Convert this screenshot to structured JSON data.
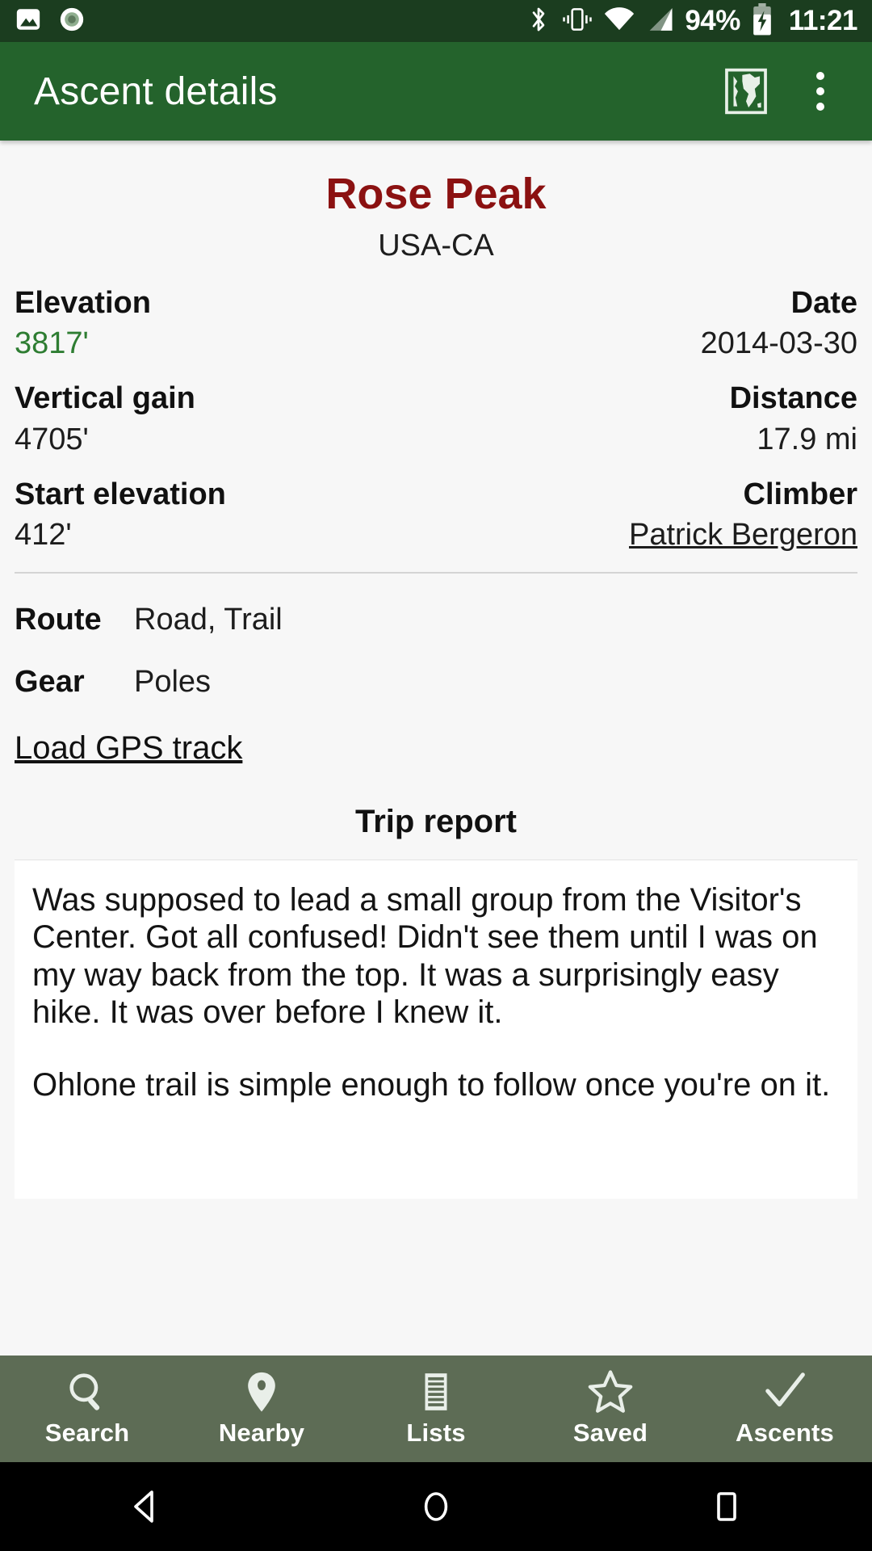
{
  "status_bar": {
    "left_icons": [
      "image-icon",
      "record-icon"
    ],
    "right_icons": [
      "bluetooth-icon",
      "vibrate-icon",
      "wifi-icon",
      "signal-icon"
    ],
    "battery_percent": "94%",
    "battery_state": "charging",
    "clock": "11:21"
  },
  "app_bar": {
    "title": "Ascent details",
    "actions": [
      "world-map-icon",
      "overflow-menu-icon"
    ]
  },
  "peak": {
    "name": "Rose Peak",
    "region": "USA-CA"
  },
  "stats": [
    {
      "left_label": "Elevation",
      "left_value": "3817'",
      "left_style": "green",
      "right_label": "Date",
      "right_value": "2014-03-30",
      "right_style": "plain"
    },
    {
      "left_label": "Vertical gain",
      "left_value": "4705'",
      "left_style": "plain",
      "right_label": "Distance",
      "right_value": "17.9 mi",
      "right_style": "plain"
    },
    {
      "left_label": "Start elevation",
      "left_value": "412'",
      "left_style": "plain",
      "right_label": "Climber",
      "right_value": "Patrick Bergeron",
      "right_style": "link"
    }
  ],
  "details": [
    {
      "key": "Route",
      "value": "Road, Trail"
    },
    {
      "key": "Gear",
      "value": "Poles"
    }
  ],
  "gps_link": "Load GPS track",
  "trip_report": {
    "heading": "Trip report",
    "paragraphs": [
      "Was supposed to lead a small group from the Visitor's Center. Got all confused! Didn't see them until I was on my way back from the top. It was a surprisingly easy hike. It was over before I knew it.",
      "Ohlone trail is simple enough to follow once you're on it."
    ]
  },
  "bottom_nav": [
    {
      "label": "Search",
      "icon": "search-icon"
    },
    {
      "label": "Nearby",
      "icon": "map-pin-icon"
    },
    {
      "label": "Lists",
      "icon": "list-icon"
    },
    {
      "label": "Saved",
      "icon": "star-icon"
    },
    {
      "label": "Ascents",
      "icon": "check-icon"
    }
  ],
  "system_nav": [
    "back-icon",
    "home-icon",
    "recents-icon"
  ],
  "colors": {
    "status_bar": "#1b3d1f",
    "app_bar": "#24632c",
    "peak_title": "#8b1111",
    "elevation_green": "#2e7d32",
    "bottom_nav": "#5d6c55",
    "page_bg": "#f7f7f7"
  }
}
